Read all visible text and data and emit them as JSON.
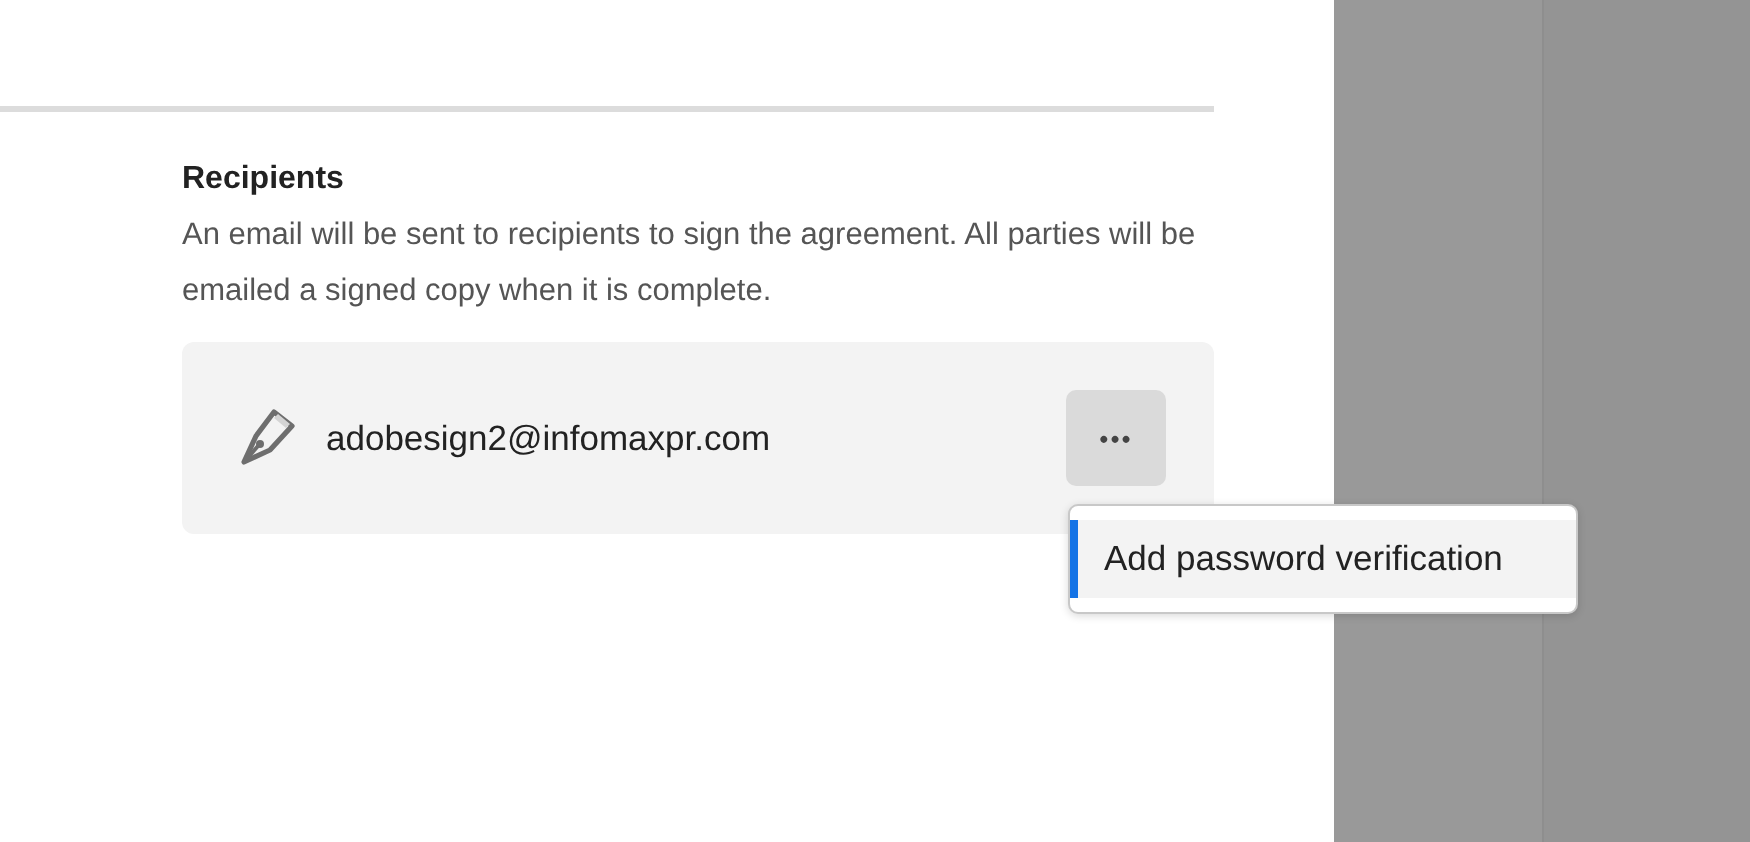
{
  "recipients": {
    "title": "Recipients",
    "description": "An email will be sent to recipients to sign the agreement. All parties will be emailed a signed copy when it is complete.",
    "items": [
      {
        "email": "adobesign2@infomaxpr.com",
        "more_button": "•••",
        "menu_open": true
      }
    ]
  },
  "menu": {
    "items": [
      {
        "label": "Add password verification",
        "selected": true
      }
    ]
  }
}
